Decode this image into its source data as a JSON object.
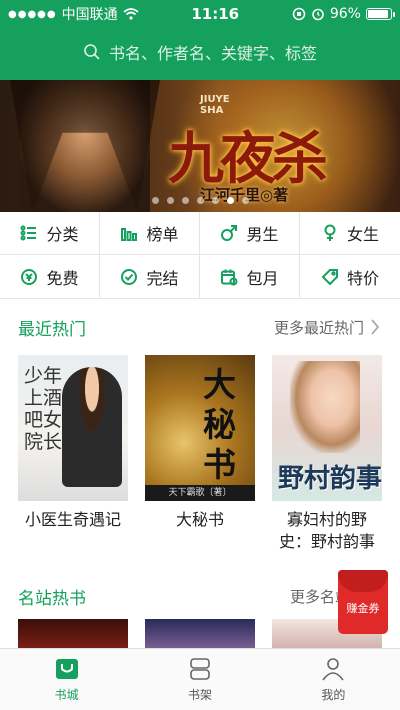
{
  "status": {
    "carrier": "中国联通",
    "time": "11:16",
    "battery": "96%",
    "battery_level": 0.96
  },
  "search": {
    "placeholder": "书名、作者名、关键字、标签"
  },
  "banner": {
    "logo_en_1": "JIUYE",
    "logo_en_2": "SHA",
    "title": "九夜杀",
    "author": "江河千里◎著",
    "page_count": 7,
    "active_index": 5
  },
  "categories": [
    {
      "label": "分类",
      "icon": "list-icon"
    },
    {
      "label": "榜单",
      "icon": "chart-icon"
    },
    {
      "label": "男生",
      "icon": "male-icon"
    },
    {
      "label": "女生",
      "icon": "female-icon"
    },
    {
      "label": "免费",
      "icon": "coin-icon"
    },
    {
      "label": "完结",
      "icon": "check-icon"
    },
    {
      "label": "包月",
      "icon": "calendar-icon"
    },
    {
      "label": "特价",
      "icon": "tag-icon"
    }
  ],
  "recent": {
    "title": "最近热门",
    "more": "更多最近热门",
    "books": [
      {
        "title": "小医生奇遇记",
        "cover_text": "少年上酒吧女院长"
      },
      {
        "title": "大秘书",
        "cover_text": "大秘书",
        "cover_footer": "天下霸歌〔著〕"
      },
      {
        "title": "寡妇村的野史：野村韵事",
        "cover_text": "野村韵事"
      }
    ]
  },
  "famous": {
    "title": "名站热书",
    "more": "更多名站热书"
  },
  "coupon": {
    "label": "赚金券"
  },
  "tabs": [
    {
      "label": "书城",
      "active": true
    },
    {
      "label": "书架",
      "active": false
    },
    {
      "label": "我的",
      "active": false
    }
  ],
  "colors": {
    "brand": "#16a05d",
    "coupon": "#e02a2a"
  }
}
